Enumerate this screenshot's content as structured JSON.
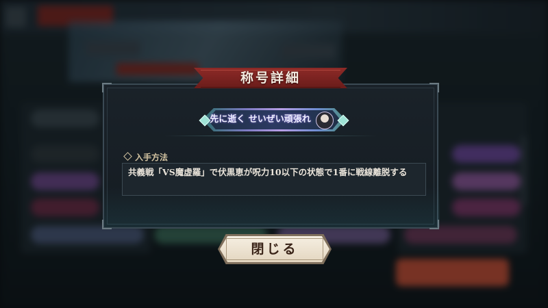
{
  "dialog": {
    "title": "称号詳細",
    "title_plate_text": "先に逝く せいぜい頑張れ",
    "acquisition_label": "入手方法",
    "acquisition_text": "共義戦「VS魔虚羅」で伏黒恵が呪力10以下の状態で1番に戦線離脱する",
    "close_label": "閉じる"
  },
  "colors": {
    "ribbon_red": "#7d2320",
    "panel_bg": "#171e24",
    "label_gold": "#d4c4a2",
    "button_cream": "#efe6d6"
  },
  "icons": {
    "acquisition": "diamond-bullet-icon",
    "portrait": "character-portrait-icon"
  }
}
